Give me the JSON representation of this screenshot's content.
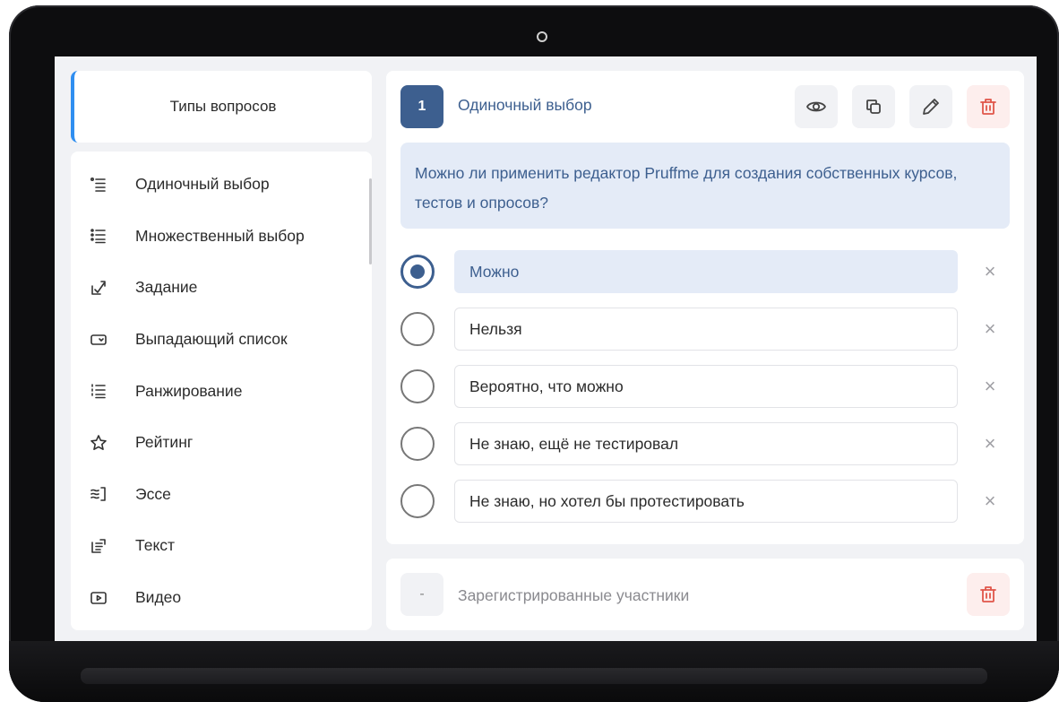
{
  "sidebar": {
    "header": "Типы вопросов",
    "items": [
      {
        "label": "Одиночный выбор",
        "icon": "single-choice-icon"
      },
      {
        "label": "Множественный выбор",
        "icon": "multiple-choice-icon"
      },
      {
        "label": "Задание",
        "icon": "task-icon"
      },
      {
        "label": "Выпадающий список",
        "icon": "dropdown-icon"
      },
      {
        "label": "Ранжирование",
        "icon": "ranking-icon"
      },
      {
        "label": "Рейтинг",
        "icon": "star-icon"
      },
      {
        "label": "Эссе",
        "icon": "essay-icon"
      },
      {
        "label": "Текст",
        "icon": "text-icon"
      },
      {
        "label": "Видео",
        "icon": "video-icon"
      }
    ]
  },
  "question": {
    "number": "1",
    "type": "Одиночный выбор",
    "text": "Можно ли применить редактор Pruffme для создания собственных курсов, тестов и опросов?",
    "actions": [
      "eye-icon",
      "copy-icon",
      "pencil-icon",
      "trash-icon"
    ],
    "answers": [
      {
        "label": "Можно",
        "selected": true
      },
      {
        "label": "Нельзя",
        "selected": false
      },
      {
        "label": "Вероятно, что можно",
        "selected": false
      },
      {
        "label": "Не знаю, ещё не тестировал",
        "selected": false
      },
      {
        "label": "Не знаю, но хотел бы протестировать",
        "selected": false
      }
    ],
    "remove_symbol": "×"
  },
  "second_card": {
    "number": "-",
    "title": "Зарегистрированные участники"
  },
  "colors": {
    "accent": "#3d5f8f",
    "highlight": "#e4ebf7",
    "sidebar_accent": "#2f8ef0",
    "danger": "#e0564a"
  }
}
